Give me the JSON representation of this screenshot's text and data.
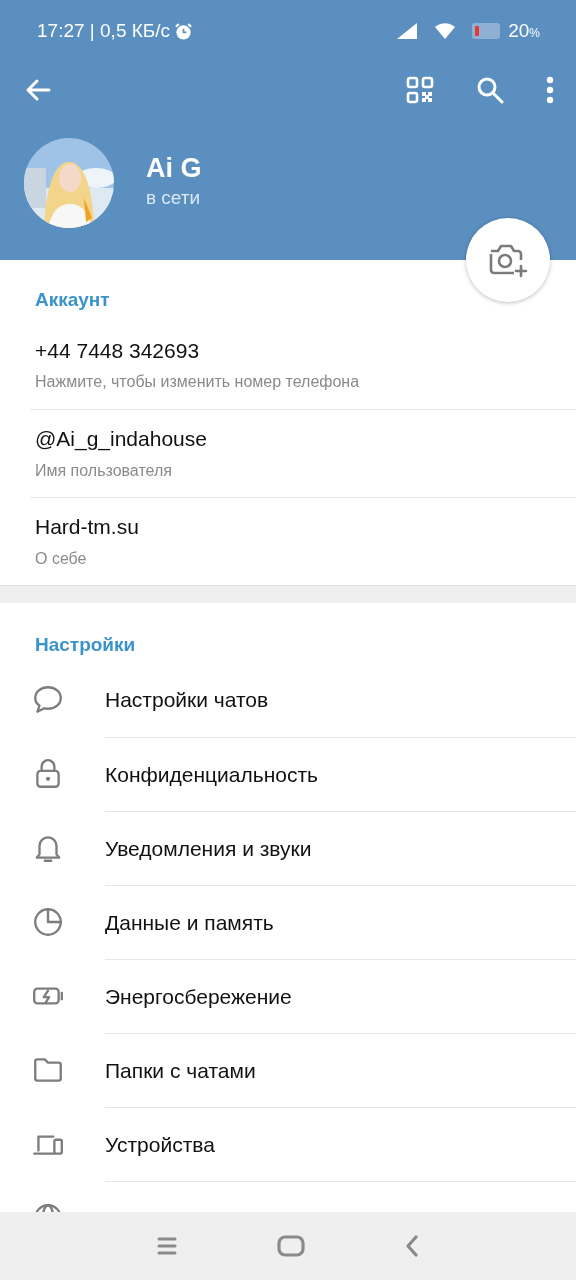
{
  "status_bar": {
    "time": "17:27 | 0,5 КБ/с",
    "battery": "20",
    "battery_unit": "%"
  },
  "profile": {
    "name": "Ai G",
    "status": "в сети"
  },
  "account": {
    "title": "Аккаунт",
    "rows": [
      {
        "value": "+44 7448 342693",
        "caption": "Нажмите, чтобы изменить номер телефона"
      },
      {
        "value": "@Ai_g_indahouse",
        "caption": "Имя пользователя"
      },
      {
        "value": "Hard-tm.su",
        "caption": "О себе"
      }
    ]
  },
  "settings": {
    "title": "Настройки",
    "items": [
      {
        "kind": "chat",
        "label": "Настройки чатов"
      },
      {
        "kind": "lock",
        "label": "Конфиденциальность"
      },
      {
        "kind": "bell",
        "label": "Уведомления и звуки"
      },
      {
        "kind": "pie",
        "label": "Данные и память"
      },
      {
        "kind": "battery",
        "label": "Энергосбережение"
      },
      {
        "kind": "folder",
        "label": "Папки с чатами"
      },
      {
        "kind": "devices",
        "label": "Устройства"
      },
      {
        "kind": "globe"
      }
    ]
  }
}
